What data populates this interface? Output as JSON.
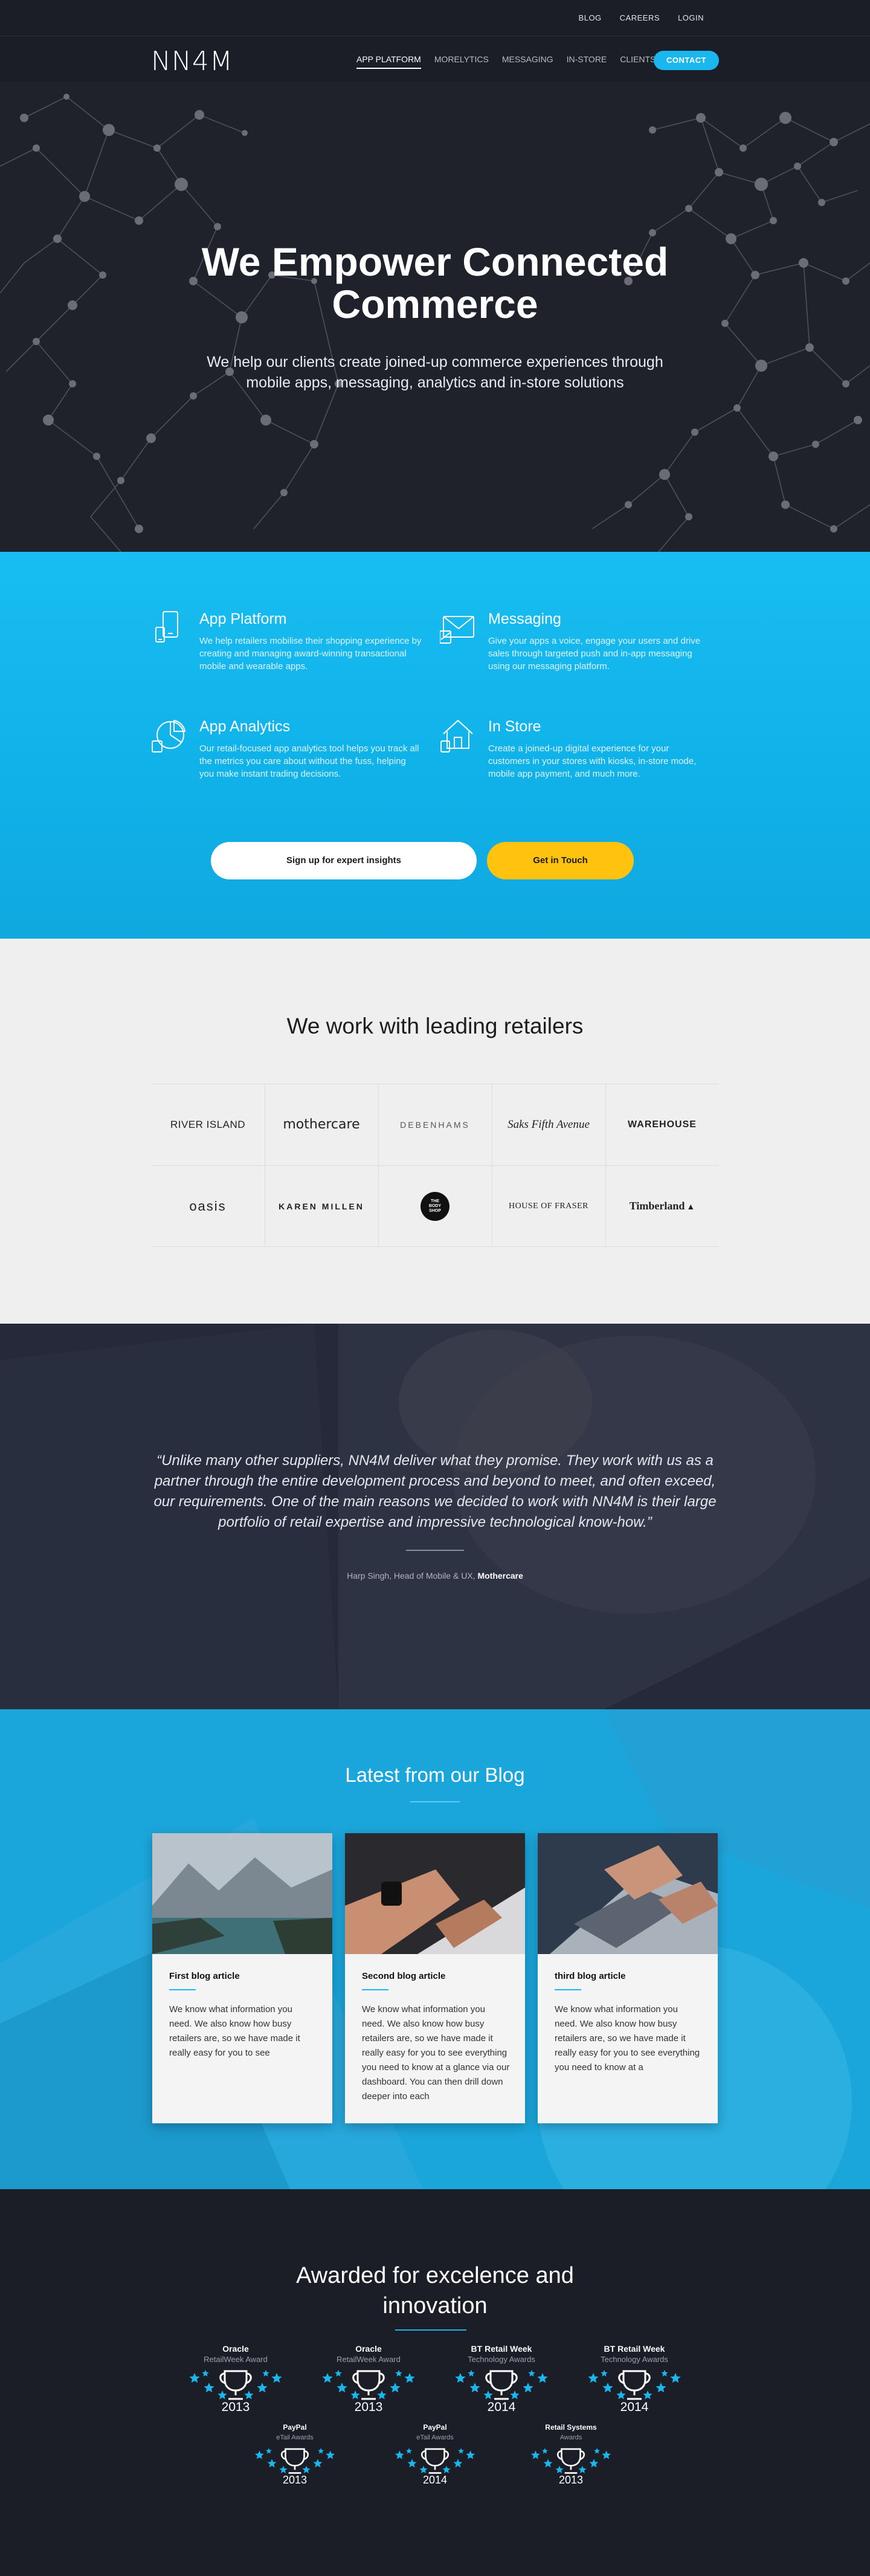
{
  "utility_nav": [
    "BLOG",
    "CAREERS",
    "LOGIN"
  ],
  "brand": {
    "logo_text": "NN4M",
    "accent": "#1ab7ef",
    "cta_yellow": "#ffc20e",
    "dark_bg": "#1d2029"
  },
  "main_nav": {
    "items": [
      "APP PLATFORM",
      "MORELYTICS",
      "MESSAGING",
      "IN-STORE",
      "CLIENTS"
    ],
    "active_index": 0,
    "contact_label": "CONTACT"
  },
  "hero": {
    "title": "We Empower Connected Commerce",
    "subtitle": "We help our clients create joined-up commerce experiences through mobile apps, messaging, analytics and in-store solutions"
  },
  "services": {
    "items": [
      {
        "icon": "mobile-devices-icon",
        "title": "App Platform",
        "text": "We help retailers mobilise their shopping experience by creating and managing award-winning transactional mobile and wearable apps."
      },
      {
        "icon": "envelope-icon",
        "title": "Messaging",
        "text": "Give your apps a voice, engage your users and drive sales through targeted push and in-app messaging using our messaging platform."
      },
      {
        "icon": "pie-chart-icon",
        "title": "App Analytics",
        "text": "Our retail-focused app analytics tool helps you track all the metrics you care about without the fuss, helping you make instant trading decisions."
      },
      {
        "icon": "store-home-icon",
        "title": "In Store",
        "text": "Create a joined-up digital experience for your customers in your stores with kiosks, in-store mode, mobile app payment, and much more."
      }
    ],
    "signup_label": "Sign up for expert insights",
    "getintouch_label": "Get in Touch"
  },
  "retailers": {
    "title": "We work with leading retailers",
    "logos": [
      "RIVER ISLAND",
      "mothercare",
      "DEBENHAMS",
      "Saks Fifth Avenue",
      "WAREHOUSE",
      "oasis",
      "KAREN MILLEN",
      "THE BODY SHOP",
      "HOUSE OF FRASER",
      "Timberland"
    ]
  },
  "testimonial": {
    "quote": "“Unlike many other suppliers, NN4M deliver what they promise. They work with us as a partner through the entire development process and beyond to meet, and often exceed, our requirements. One of the main reasons we decided to work with NN4M is their large portfolio of retail expertise and impressive technological know-how.”",
    "author": "Harp Singh, Head of Mobile & UX,",
    "company": "Mothercare"
  },
  "blog": {
    "title": "Latest from our Blog",
    "posts": [
      {
        "title": "First blog article",
        "excerpt": "We know what information you need. We also know how busy retailers are, so we have made it really easy for you to see"
      },
      {
        "title": "Second blog article",
        "excerpt": "We know what information you need. We also know how busy retailers are, so we have made it really easy for you to see everything you need to know at a glance via our dashboard. You can then drill down deeper into each"
      },
      {
        "title": "third blog article",
        "excerpt": "We know what information you need. We also know how busy retailers are, so we have made it really easy for you to see everything you need to know at a"
      }
    ]
  },
  "awards": {
    "title": "Awarded for excelence and innovation",
    "items": [
      {
        "name": "Oracle",
        "sub": "RetailWeek Award",
        "year": "2013"
      },
      {
        "name": "Oracle",
        "sub": "RetailWeek Award",
        "year": "2013"
      },
      {
        "name": "BT Retail Week",
        "sub": "Technology Awards",
        "year": "2014"
      },
      {
        "name": "BT Retail Week",
        "sub": "Technology Awards",
        "year": "2014"
      },
      {
        "name": "PayPal",
        "sub": "eTail Awards",
        "year": "2013"
      },
      {
        "name": "PayPal",
        "sub": "eTail Awards",
        "year": "2014"
      },
      {
        "name": "Retail Systems",
        "sub": "Awards",
        "year": "2013"
      }
    ]
  }
}
